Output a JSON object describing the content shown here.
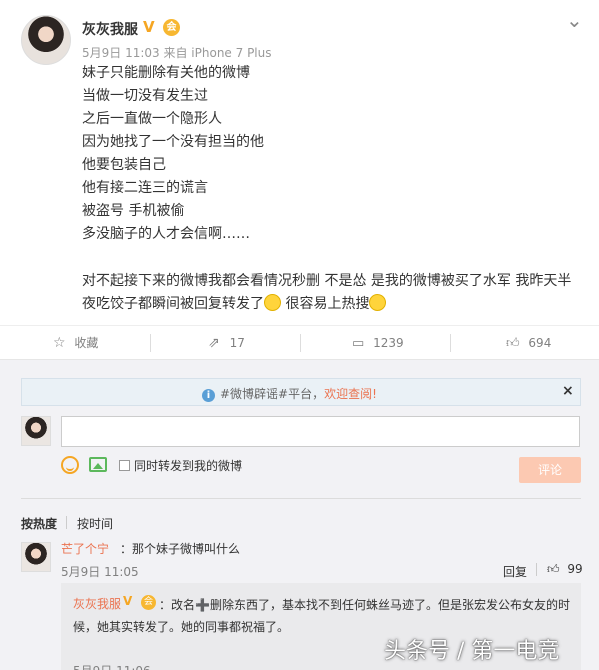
{
  "post": {
    "author": "灰灰我服",
    "meta": "5月9日 11:03 来自 iPhone 7 Plus",
    "lines": [
      "妹子只能删除有关他的微博",
      "当做一切没有发生过",
      "之后一直做一个隐形人",
      "因为她找了一个没有担当的他",
      "他要包装自己",
      "他有接二连三的谎言",
      "被盗号 手机被偷",
      "多没脑子的人才会信啊……"
    ],
    "para_part1": "对不起接下来的微博我都会看情况秒删 不是怂 是我的微博被买了水军 我昨天半夜吃饺子都瞬间被回复转发了",
    "para_part2": " 很容易上热搜"
  },
  "actions": {
    "favorite": "收藏",
    "repost": "17",
    "comment": "1239",
    "like": "694"
  },
  "notice": {
    "tag": "#微博辟谣#平台，",
    "link": "欢迎查阅!"
  },
  "composer": {
    "sync_label": "同时转发到我的微博",
    "submit": "评论"
  },
  "sort": {
    "hot": "按热度",
    "time": "按时间"
  },
  "comment": {
    "name": "芒了个宁",
    "text": "：那个妹子微博叫什么",
    "date": "5月9日 11:05",
    "reply": "回复",
    "likes": "99"
  },
  "reply": {
    "name": "灰灰我服",
    "text": "：改名➕删除东西了，基本找不到任何蛛丝马迹了。但是张宏发公布女友的时候，她其实转发了。她的同事都祝福了。",
    "date": "5月9日 11:06"
  },
  "watermark": "头条号 / 第一电竞",
  "colors": {
    "accent": "#eb7350",
    "verified": "#f5a623",
    "comment_bg": "#f2f2f5"
  }
}
